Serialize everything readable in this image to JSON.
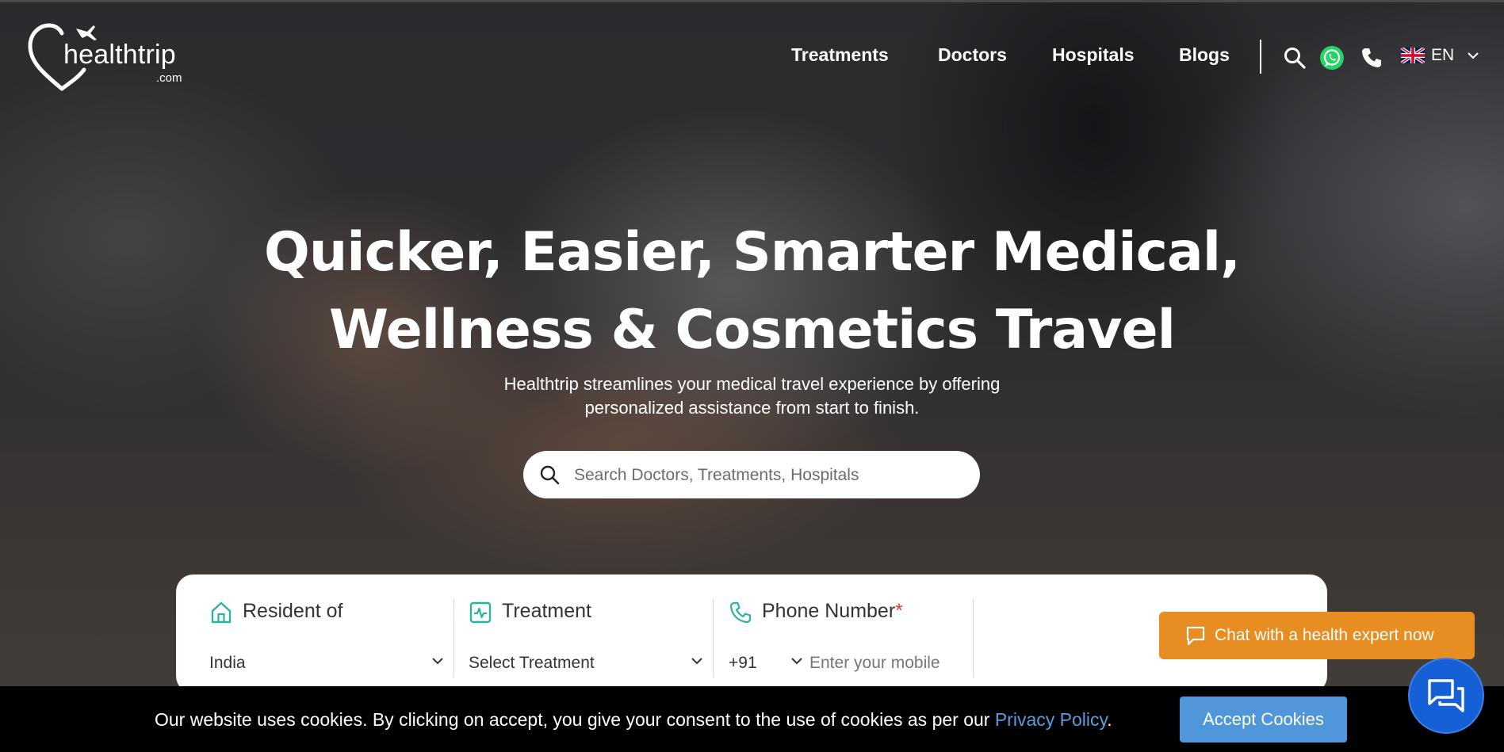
{
  "brand": {
    "name": "healthtrip",
    "suffix": ".com"
  },
  "nav": {
    "items": [
      "Treatments",
      "Doctors",
      "Hospitals",
      "Blogs"
    ],
    "language": "EN",
    "icons": [
      "search-icon",
      "whatsapp-icon",
      "phone-icon",
      "uk-flag-icon",
      "chevron-down-icon"
    ]
  },
  "hero": {
    "headline_line1": "Quicker, Easier, Smarter Medical,",
    "headline_line2": "Wellness & Cosmetics Travel",
    "subtitle_line1": "Healthtrip streamlines your medical travel experience by offering",
    "subtitle_line2": "personalized assistance from start to finish.",
    "search_placeholder": "Search Doctors, Treatments, Hospitals"
  },
  "form": {
    "resident": {
      "label": "Resident of",
      "value": "India"
    },
    "treatment": {
      "label": "Treatment",
      "value": "Select Treatment"
    },
    "phone": {
      "label": "Phone Number",
      "required_mark": "*",
      "code": "+91",
      "placeholder": "Enter your mobile"
    },
    "cta_label": "Chat with a health expert now"
  },
  "cookie": {
    "text": "Our website uses cookies. By clicking on accept, you give your consent to the use of cookies as per our",
    "link": "Privacy Policy",
    "end": ".",
    "accept_label": "Accept Cookies"
  },
  "colors": {
    "accent_orange": "#e88d22",
    "accept_blue": "#5096db",
    "fab_blue": "#1560d6",
    "icon_teal": "#2bb3a0",
    "whatsapp_green": "#25d366"
  }
}
